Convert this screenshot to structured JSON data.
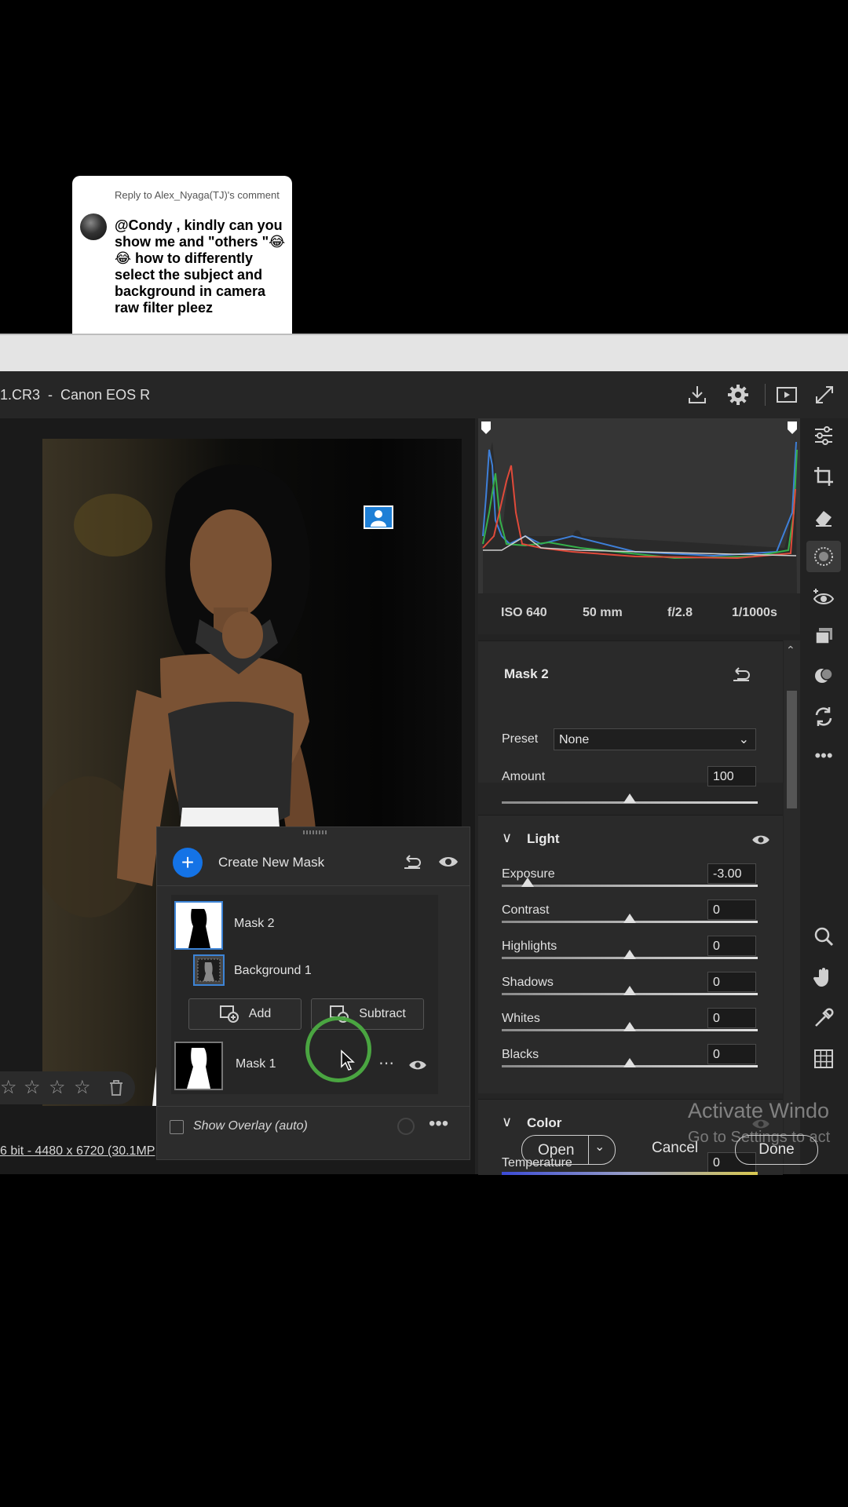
{
  "reply": {
    "header": "Reply to Alex_Nyaga(TJ)'s comment",
    "message": "@Condy , kindly can you show me and \"others \"😂😂 how to differently select the subject and background in camera raw filter pleez"
  },
  "titlebar": {
    "title": "1.CR3  -  Canon EOS R"
  },
  "histogram": {
    "iso": "ISO 640",
    "focal_length": "50 mm",
    "aperture": "f/2.8",
    "shutter": "1/1000s"
  },
  "mask_settings": {
    "title": "Mask 2",
    "preset_label": "Preset",
    "preset_value": "None",
    "amount_label": "Amount",
    "amount_value": "100",
    "amount_level": 0.5
  },
  "light": {
    "title": "Light",
    "sliders": [
      {
        "label": "Exposure",
        "value": "-3.00",
        "level": 0.1
      },
      {
        "label": "Contrast",
        "value": "0",
        "level": 0.5
      },
      {
        "label": "Highlights",
        "value": "0",
        "level": 0.5
      },
      {
        "label": "Shadows",
        "value": "0",
        "level": 0.5
      },
      {
        "label": "Whites",
        "value": "0",
        "level": 0.5
      },
      {
        "label": "Blacks",
        "value": "0",
        "level": 0.5
      }
    ]
  },
  "color": {
    "title": "Color",
    "temperature_label": "Temperature",
    "temperature_value": "0"
  },
  "mask_panel": {
    "create_label": "Create New Mask",
    "masks": [
      {
        "name": "Mask 2"
      },
      {
        "name": "Background 1"
      },
      {
        "name": "Mask 1"
      }
    ],
    "add_label": "Add",
    "subtract_label": "Subtract",
    "overlay_label": "Show Overlay (auto)"
  },
  "status": {
    "image_info": "6 bit - 4480 x 6720 (30.1MP"
  },
  "buttons": {
    "open": "Open",
    "cancel": "Cancel",
    "done": "Done"
  },
  "watermark": {
    "line1": "Activate Windo",
    "line2": "Go to Settings to act"
  },
  "colors": {
    "accent": "#1473e6",
    "cursor_ring": "#4aa541"
  }
}
